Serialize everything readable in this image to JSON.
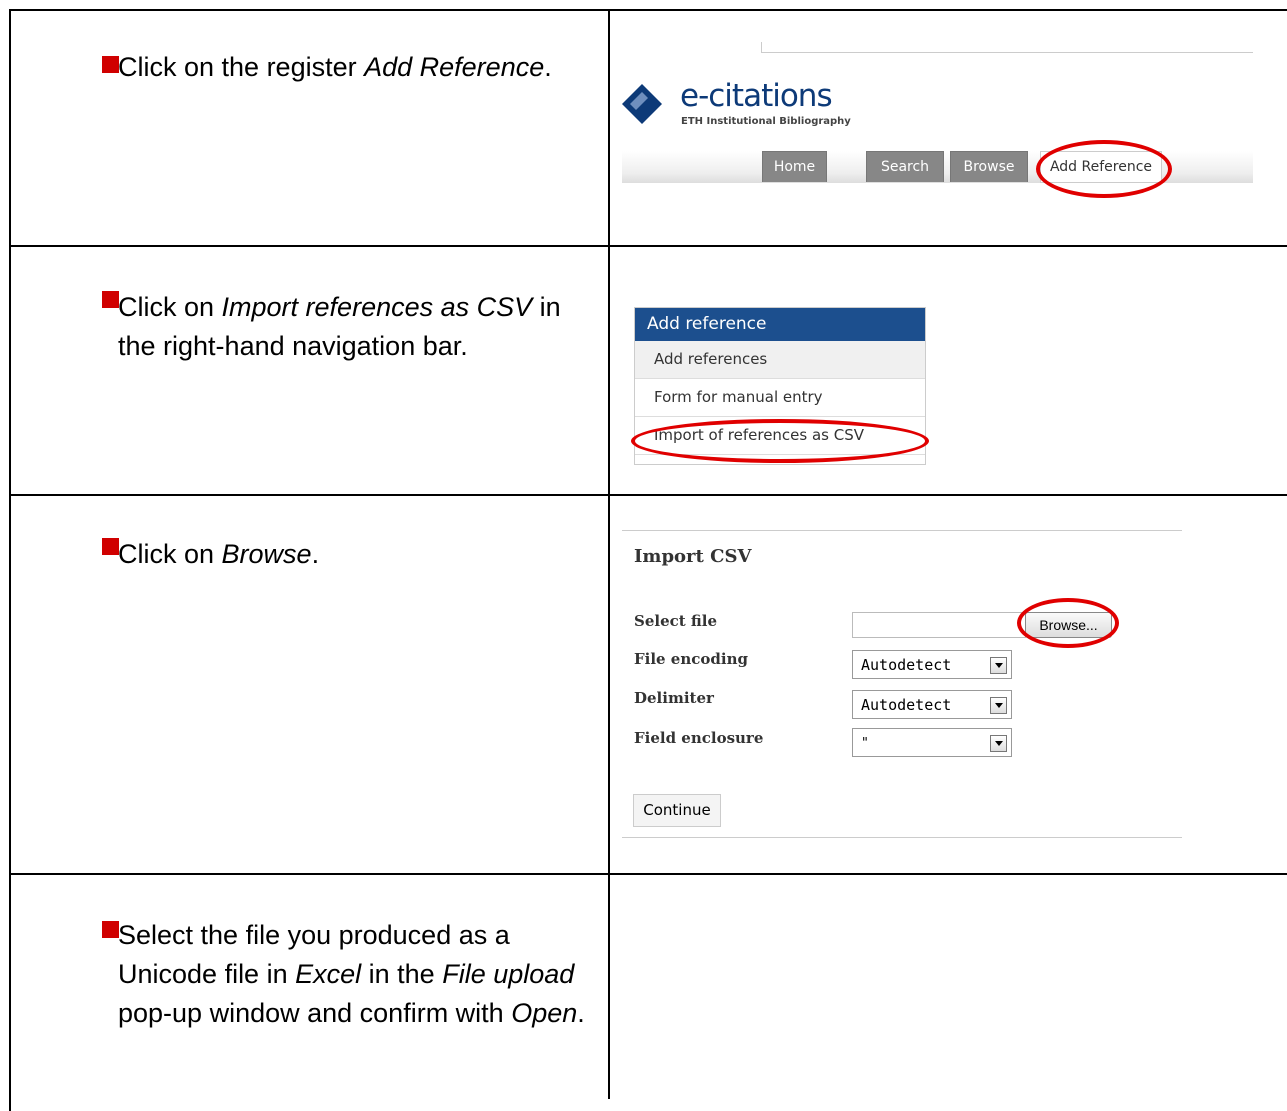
{
  "rows": [
    {
      "text": [
        "Click on the register ",
        "Add Reference",
        "."
      ]
    },
    {
      "text": [
        "Click on ",
        "Import references as CSV",
        " in the right-hand navigation bar."
      ]
    },
    {
      "text": [
        "Click on ",
        "Browse",
        "."
      ]
    },
    {
      "text": [
        "Select the file you produced as a Unicode file in ",
        "Excel",
        " in the ",
        "File upload",
        " pop-up window and confirm with ",
        "Open",
        "."
      ]
    }
  ],
  "ecitations": {
    "logo_name": "e-citations",
    "logo_subtitle": "ETH Institutional Bibliography",
    "tabs": [
      "Home",
      "Search",
      "Browse",
      "Add Reference"
    ]
  },
  "nav_menu": {
    "header": "Add reference",
    "items": [
      "Add references",
      "Form for manual entry",
      "Import of references as CSV"
    ]
  },
  "import_form": {
    "title": "Import CSV",
    "select_file_label": "Select file",
    "browse_label": "Browse...",
    "encoding_label": "File encoding",
    "encoding_value": "Autodetect",
    "delimiter_label": "Delimiter",
    "delimiter_value": "Autodetect",
    "enclosure_label": "Field enclosure",
    "enclosure_value": "\"",
    "continue_label": "Continue"
  },
  "colors": {
    "bullet": "#d00000",
    "highlight": "#e00000",
    "nav_header": "#1c4f8e",
    "logo": "#0d3a78"
  }
}
